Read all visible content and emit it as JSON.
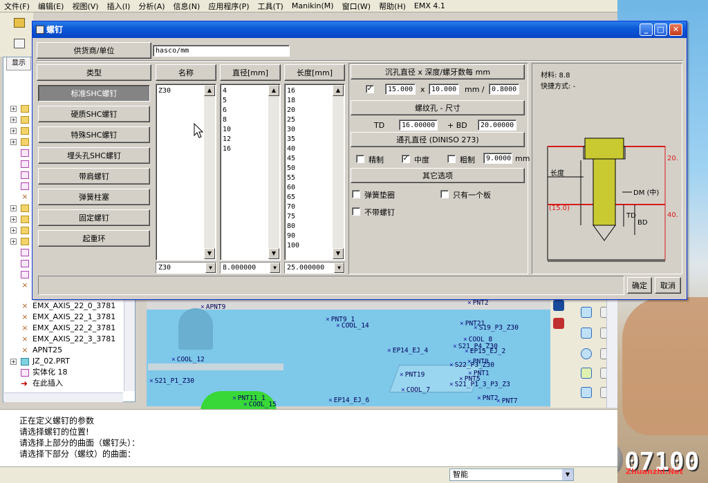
{
  "menubar": [
    "文件(F)",
    "编辑(E)",
    "视图(V)",
    "插入(I)",
    "分析(A)",
    "信息(N)",
    "应用程序(P)",
    "工具(T)",
    "Manikin(M)",
    "窗口(W)",
    "帮助(H)",
    "EMX 4.1"
  ],
  "tree": {
    "tab_label": "显示",
    "items": [
      {
        "label": "EMX_AXIS_22_0_3781"
      },
      {
        "label": "EMX_AXIS_22_1_3781"
      },
      {
        "label": "EMX_AXIS_22_2_3781"
      },
      {
        "label": "EMX_AXIS_22_3_3781"
      },
      {
        "label": "APNT25"
      },
      {
        "label": "JZ_02.PRT"
      },
      {
        "label": "实体化 18"
      },
      {
        "label": "在此插入"
      }
    ]
  },
  "viewport": {
    "points": [
      "APNT9",
      "PNT9_1",
      "COOL_14",
      "PNT2",
      "PNT21",
      "S19_P3_Z30",
      "COOL_8",
      "S21_P4_Z30",
      "EP14_EJ_4",
      "EP15_EJ_2",
      "PNT0",
      "COOL_12",
      "S22_P3_Z30",
      "PNT1",
      "PNT19",
      "PNT5",
      "S21_P1_Z30",
      "S21_P1_3_P3_Z3",
      "COOL_7",
      "PNT11_1",
      "COOL_15",
      "EP14_EJ_6",
      "PNT2",
      "PNT7"
    ]
  },
  "messages": [
    "正在定义螺钉的参数",
    "请选择螺钉的位置!",
    "请选择上部分的曲面（螺钉头）：",
    "请选择下部分（螺纹）的曲面："
  ],
  "status": {
    "smart": "智能"
  },
  "dialog": {
    "title": "螺钉",
    "supplier_label": "供货商/单位",
    "supplier_value": "hasco/mm",
    "type_header": "类型",
    "types": [
      "标准SHC螺钉",
      "硬质SHC螺钉",
      "特殊SHC螺钉",
      "埋头孔SHC螺钉",
      "带肩螺钉",
      "弹簧柱塞",
      "固定螺钉",
      "起重环"
    ],
    "name_header": "名称",
    "names": [
      "Z30"
    ],
    "name_selected": "Z30",
    "diameter_header": "直径[mm]",
    "diameters": [
      "4",
      "5",
      "6",
      "8",
      "10",
      "12",
      "16"
    ],
    "diameter_selected": "8.000000",
    "length_header": "长度[mm]",
    "lengths": [
      "16",
      "18",
      "20",
      "25",
      "30",
      "35",
      "40",
      "45",
      "50",
      "55",
      "60",
      "65",
      "70",
      "75",
      "80",
      "90",
      "100"
    ],
    "length_selected": "25.000000",
    "counterbore": {
      "header": "沉孔直径 x 深度/螺牙数每 mm",
      "checked": true,
      "diameter": "15.000",
      "x": "x",
      "depth": "10.000",
      "unit": "mm /",
      "pitch": "0.8000"
    },
    "thread": {
      "header": "螺纹孔 - 尺寸",
      "td_label": "TD",
      "td_value": "16.00000",
      "bd_label": "+ BD",
      "bd_value": "20.00000"
    },
    "through": {
      "header": "通孔直径 (DINISO 273)",
      "options": [
        {
          "label": "精制",
          "checked": false
        },
        {
          "label": "中度",
          "checked": true
        },
        {
          "label": "粗制",
          "checked": false
        }
      ],
      "value": "9.0000",
      "unit": "mm"
    },
    "other": {
      "header": "其它选项",
      "options": [
        {
          "label": "弹簧垫圈",
          "checked": false
        },
        {
          "label": "只有一个板",
          "checked": false
        },
        {
          "label": "不带螺钉",
          "checked": false
        }
      ]
    },
    "preview": {
      "material": "材料: 8.8",
      "fastening": "快捷方式: -",
      "length_label": "长度",
      "dm_label": "DM (中)",
      "td_label": "TD",
      "bd_label": "BD",
      "dim_top": "20.",
      "dim_bottom": "40.",
      "dim_left": "(15.0)"
    },
    "ok_label": "确定",
    "cancel_label": "取消"
  },
  "watermark": {
    "number": "07100",
    "site": "Zhuanzhi.Net"
  },
  "colors": {
    "title_blue": "#0a58d6",
    "bolt": "#c9c932",
    "red_dim": "#d81818"
  }
}
